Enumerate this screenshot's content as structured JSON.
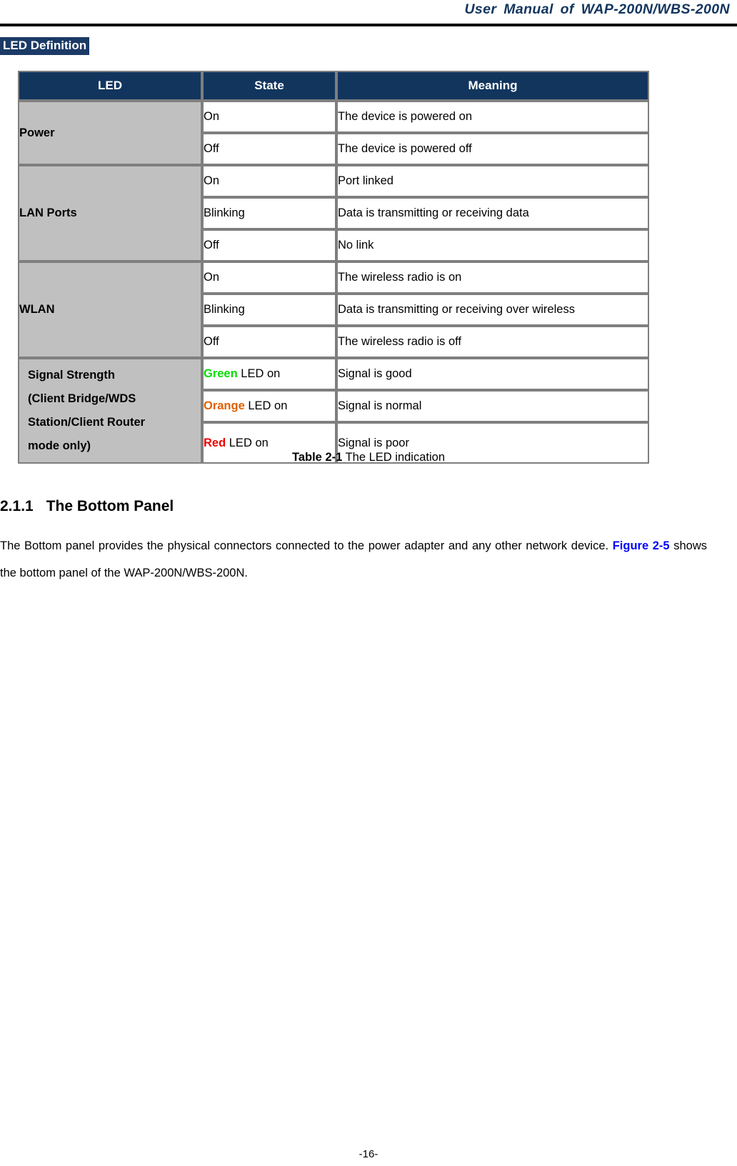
{
  "header": {
    "title": "User Manual of WAP-200N/WBS-200N"
  },
  "section_label": "LED Definition",
  "table": {
    "columns": [
      "LED",
      "State",
      "Meaning"
    ],
    "groups": [
      {
        "led": "Power",
        "rows": [
          {
            "state": "On",
            "state_color": null,
            "meaning": "The device is powered on"
          },
          {
            "state": "Off",
            "state_color": null,
            "meaning": "The device is powered off"
          }
        ]
      },
      {
        "led": "LAN Ports",
        "rows": [
          {
            "state": "On",
            "state_color": null,
            "meaning": "Port linked"
          },
          {
            "state": "Blinking",
            "state_color": null,
            "meaning": "Data is transmitting or receiving data"
          },
          {
            "state": "Off",
            "state_color": null,
            "meaning": "No link"
          }
        ]
      },
      {
        "led": "WLAN",
        "rows": [
          {
            "state": "On",
            "state_color": null,
            "meaning": "The wireless radio is on"
          },
          {
            "state": "Blinking",
            "state_color": null,
            "meaning": "Data is transmitting or receiving over wireless"
          },
          {
            "state": "Off",
            "state_color": null,
            "meaning": "The wireless radio is off"
          }
        ]
      },
      {
        "led": "Signal Strength (Client Bridge/WDS Station/Client Router mode only)",
        "led_lines": [
          "Signal Strength",
          "(Client Bridge/WDS",
          "Station/Client Router",
          "mode only)"
        ],
        "rows": [
          {
            "state_keyword": "Green",
            "state_suffix": " LED on",
            "state_color": "#00dd00",
            "meaning": "Signal is good"
          },
          {
            "state_keyword": "Orange",
            "state_suffix": " LED on",
            "state_color": "#e06000",
            "meaning": "Signal is normal"
          },
          {
            "state_keyword": "Red",
            "state_suffix": " LED on",
            "state_color": "#ee0000",
            "meaning": "Signal is poor"
          }
        ]
      }
    ]
  },
  "caption": {
    "label": "Table 2-1",
    "text": "The LED indication"
  },
  "heading": {
    "number": "2.1.1",
    "text": "The Bottom Panel"
  },
  "paragraph": {
    "part1": "The Bottom panel provides the physical connectors connected to the power adapter and any other network device.",
    "figure_ref": "Figure 2-5",
    "part2": "shows the bottom panel of the WAP-200N/WBS-200N."
  },
  "footer": {
    "page_number": "-16-"
  },
  "colors": {
    "header_navy": "#12355e",
    "highlight_navy": "#1b3a66",
    "group_gray": "#c0c0c0",
    "border_gray": "#7f7f7f",
    "link_blue": "#0000ff",
    "green": "#00dd00",
    "orange": "#e06000",
    "red": "#ee0000"
  }
}
